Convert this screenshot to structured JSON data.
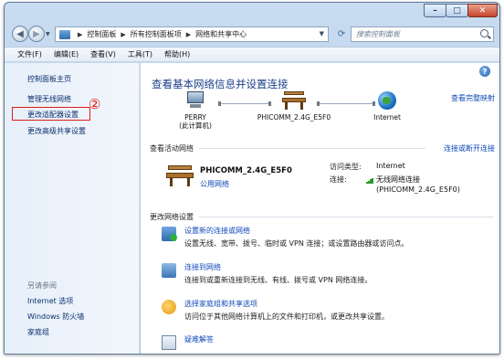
{
  "address": {
    "crumbs": [
      "控制面板",
      "所有控制面板项",
      "网络和共享中心"
    ],
    "search_placeholder": "搜索控制面板"
  },
  "window_buttons": {
    "minimize": "–",
    "maximize": "□",
    "close": "✕"
  },
  "menu": [
    "文件(F)",
    "编辑(E)",
    "查看(V)",
    "工具(T)",
    "帮助(H)"
  ],
  "sidebar": {
    "home": "控制面板主页",
    "items": [
      "管理无线网络",
      "更改适配器设置",
      "更改高级共享设置"
    ],
    "see_also_title": "另请参阅",
    "see_also": [
      "Internet 选项",
      "Windows 防火墙",
      "家庭组"
    ]
  },
  "annotation": "②",
  "main": {
    "title": "查看基本网络信息并设置连接",
    "view_full_map": "查看完整映射",
    "map": {
      "computer": {
        "name": "PERRY",
        "sub": "(此计算机)"
      },
      "router": {
        "name": "PHICOMM_2.4G_E5F0"
      },
      "internet": {
        "name": "Internet"
      }
    },
    "active_section": "查看活动网络",
    "connect_or_disconnect": "连接或断开连接",
    "network": {
      "name": "PHICOMM_2.4G_E5F0",
      "type": "公用网络",
      "access_type_label": "访问类型:",
      "access_type_value": "Internet",
      "connection_label": "连接:",
      "connection_value_line1": "无线网络连接",
      "connection_value_line2": "(PHICOMM_2.4G_E5F0)"
    },
    "change_section": "更改网络设置",
    "tasks": [
      {
        "title": "设置新的连接或网络",
        "desc": "设置无线、宽带、拨号、临时或 VPN 连接；或设置路由器或访问点。"
      },
      {
        "title": "连接到网络",
        "desc": "连接到或重新连接到无线、有线、拨号或 VPN 网络连接。"
      },
      {
        "title": "选择家庭组和共享选项",
        "desc": "访问位于其他网络计算机上的文件和打印机，或更改共享设置。"
      },
      {
        "title": "疑难解答",
        "desc": ""
      }
    ]
  },
  "colors": {
    "link": "#0f49b8",
    "title": "#1d3e8a",
    "highlight": "#e01b1b"
  }
}
